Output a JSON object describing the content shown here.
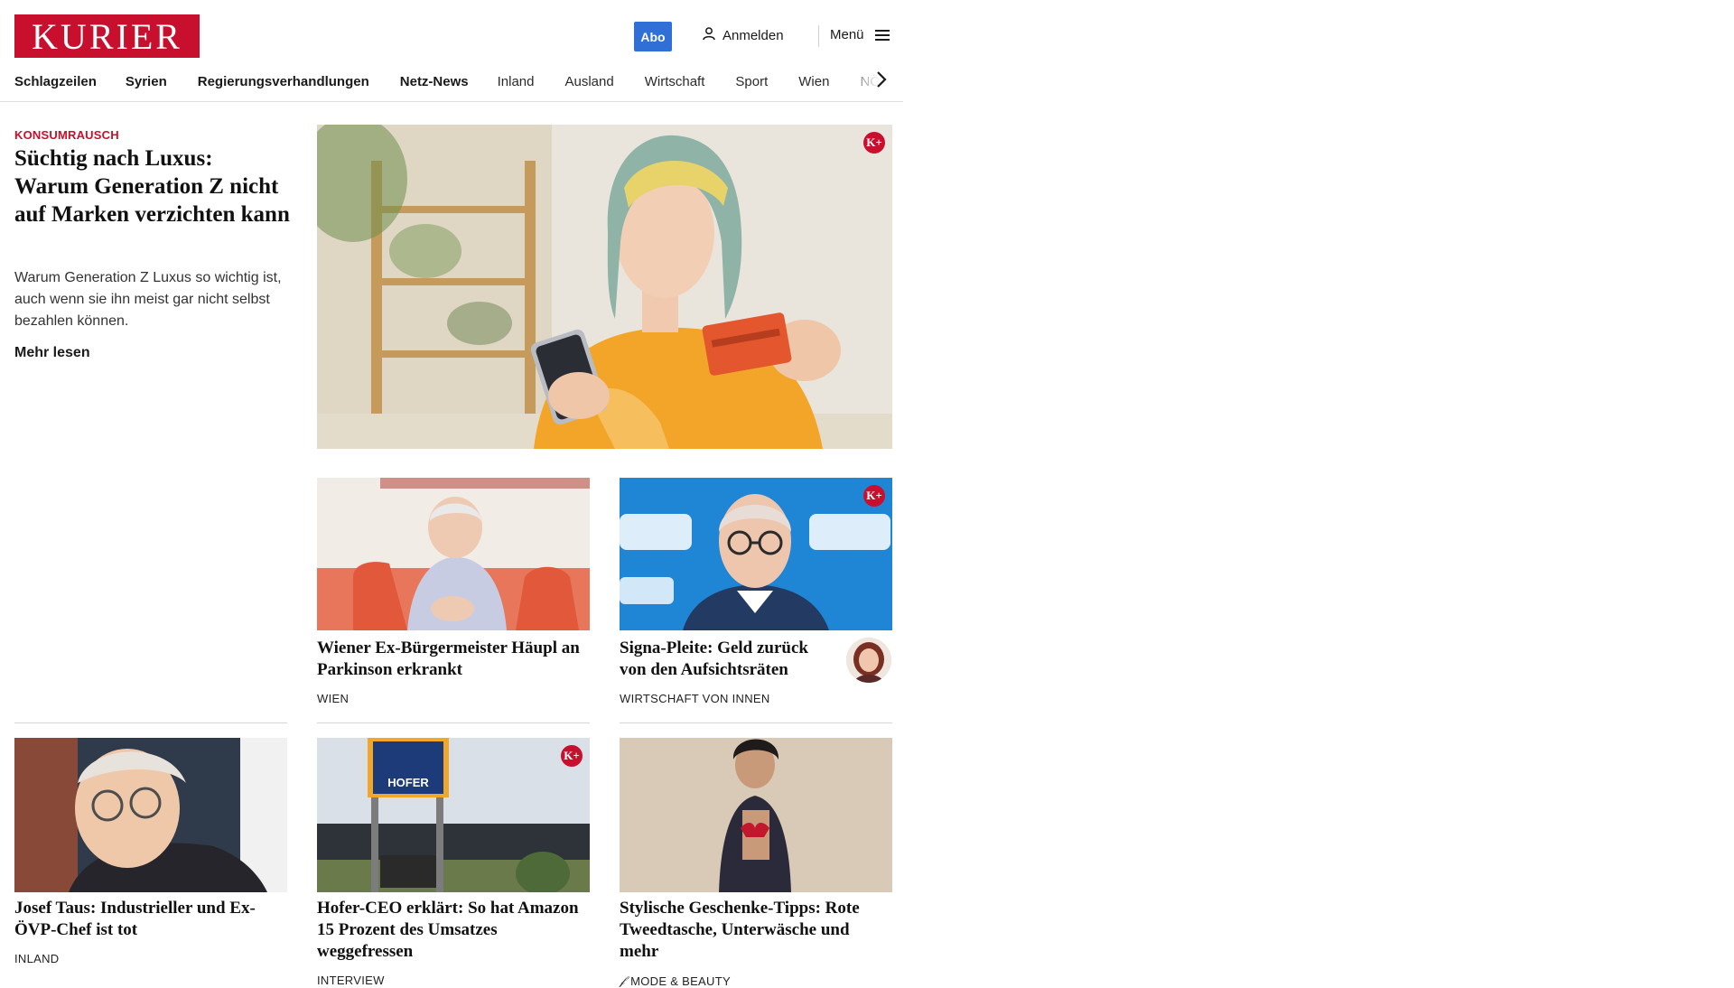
{
  "header": {
    "logo_text": "KURIER",
    "abo_label": "Abo",
    "login_label": "Anmelden",
    "menu_label": "Menü",
    "brand_color": "#c8102e",
    "abo_color": "#2f6fd6"
  },
  "nav": {
    "items": [
      "Schlagzeilen",
      "Syrien",
      "Regierungsverhandlungen",
      "Netz-News",
      "Inland",
      "Ausland",
      "Wirtschaft",
      "Sport",
      "Wien",
      "NÖ"
    ],
    "arrow_icon": "chevron-right-icon"
  },
  "lead": {
    "kicker": "KONSUMRAUSCH",
    "title": "Süchtig nach Luxus: Warum Generation Z nicht auf Marken ver­zichten kann",
    "teaser": "Warum Generation Z Luxus so wichtig ist, auch wenn sie ihn meist gar nicht selbst bezahlen können.",
    "more_label": "Mehr lesen",
    "badge": "K+"
  },
  "cards": [
    {
      "title": "Wiener Ex-Bürgermeister Häupl an Parkinson erkrankt",
      "category": "WIEN"
    },
    {
      "title": "Signa-Pleite: Geld zurück von den Aufsichtsräten",
      "category": "WIRTSCHAFT VON INNEN",
      "badge": "K+"
    },
    {
      "title": "Josef Taus: Industrieller und Ex-ÖVP-Chef ist tot",
      "category": "INLAND"
    },
    {
      "title": "Hofer-CEO erklärt: So hat Amazon 15 Prozent des Umsatzes weggefressen",
      "category": "INTERVIEW",
      "badge": "K+",
      "sign_text": "HOFER"
    },
    {
      "title": "Stylische Geschenke-Tipps: Rote Tweedtasche, Unterwäsche und mehr",
      "category": "MODE & BEAUTY"
    }
  ]
}
